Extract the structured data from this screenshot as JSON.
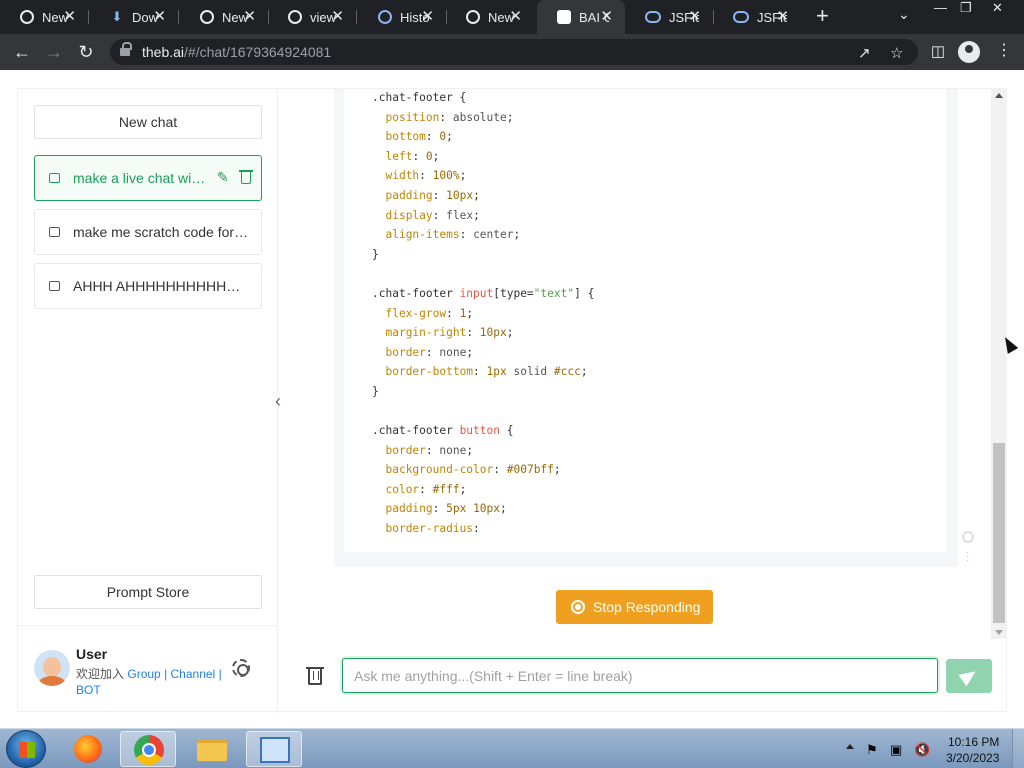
{
  "browser": {
    "tabs": [
      {
        "title": "New",
        "icon": "chrome-icon"
      },
      {
        "title": "Dow",
        "icon": "download-icon"
      },
      {
        "title": "New",
        "icon": "chrome-icon"
      },
      {
        "title": "view",
        "icon": "chrome-icon"
      },
      {
        "title": "Histo",
        "icon": "history-icon"
      },
      {
        "title": "New",
        "icon": "chrome-icon"
      },
      {
        "title": "BAI C",
        "icon": "bai-icon",
        "active": true
      },
      {
        "title": "JSFid",
        "icon": "jsfiddle-icon"
      },
      {
        "title": "JSFid",
        "icon": "jsfiddle-icon"
      }
    ],
    "close_glyph": "✕",
    "new_tab_glyph": "+",
    "url_host": "theb.ai",
    "url_path": "/#/chat/1679364924081"
  },
  "sidebar": {
    "new_chat_label": "New chat",
    "chats": [
      {
        "label": "make a live chat with html css and javascript",
        "active": true
      },
      {
        "label": "make me scratch code for a game",
        "active": false
      },
      {
        "label": "AHHH AHHHHHHHHHHHHHHHH",
        "active": false
      }
    ],
    "prompt_store_label": "Prompt Store",
    "user": {
      "name": "User",
      "join_text": "欢迎加入",
      "links": [
        "Group",
        "Channel",
        "BOT"
      ],
      "separator": " | "
    }
  },
  "code": {
    "lines": [
      [
        [
          "sel",
          ".chat-footer {"
        ]
      ],
      [
        [
          "",
          "  "
        ],
        [
          "prop",
          "position"
        ],
        [
          "",
          ": "
        ],
        [
          "val",
          "absolute"
        ],
        [
          "",
          ";"
        ]
      ],
      [
        [
          "",
          "  "
        ],
        [
          "prop",
          "bottom"
        ],
        [
          "",
          ": "
        ],
        [
          "num",
          "0"
        ],
        [
          "",
          ";"
        ]
      ],
      [
        [
          "",
          "  "
        ],
        [
          "prop",
          "left"
        ],
        [
          "",
          ": "
        ],
        [
          "num",
          "0"
        ],
        [
          "",
          ";"
        ]
      ],
      [
        [
          "",
          "  "
        ],
        [
          "prop",
          "width"
        ],
        [
          "",
          ": "
        ],
        [
          "num",
          "100%"
        ],
        [
          "",
          ";"
        ]
      ],
      [
        [
          "",
          "  "
        ],
        [
          "prop",
          "padding"
        ],
        [
          "",
          ": "
        ],
        [
          "num",
          "10px"
        ],
        [
          "",
          ";"
        ]
      ],
      [
        [
          "",
          "  "
        ],
        [
          "prop",
          "display"
        ],
        [
          "",
          ": "
        ],
        [
          "val",
          "flex"
        ],
        [
          "",
          ";"
        ]
      ],
      [
        [
          "",
          "  "
        ],
        [
          "prop",
          "align-items"
        ],
        [
          "",
          ": "
        ],
        [
          "val",
          "center"
        ],
        [
          "",
          ";"
        ]
      ],
      [
        [
          "sel",
          "}"
        ]
      ],
      [
        [
          "",
          ""
        ]
      ],
      [
        [
          "sel",
          ".chat-footer "
        ],
        [
          "tag",
          "input"
        ],
        [
          "sel",
          "[type="
        ],
        [
          "str",
          "\"text\""
        ],
        [
          "sel",
          "] {"
        ]
      ],
      [
        [
          "",
          "  "
        ],
        [
          "prop",
          "flex-grow"
        ],
        [
          "",
          ": "
        ],
        [
          "num",
          "1"
        ],
        [
          "",
          ";"
        ]
      ],
      [
        [
          "",
          "  "
        ],
        [
          "prop",
          "margin-right"
        ],
        [
          "",
          ": "
        ],
        [
          "num",
          "10px"
        ],
        [
          "",
          ";"
        ]
      ],
      [
        [
          "",
          "  "
        ],
        [
          "prop",
          "border"
        ],
        [
          "",
          ": "
        ],
        [
          "val",
          "none"
        ],
        [
          "",
          ";"
        ]
      ],
      [
        [
          "",
          "  "
        ],
        [
          "prop",
          "border-bottom"
        ],
        [
          "",
          ": "
        ],
        [
          "num",
          "1px"
        ],
        [
          "val",
          " solid "
        ],
        [
          "num",
          "#ccc"
        ],
        [
          "",
          ";"
        ]
      ],
      [
        [
          "sel",
          "}"
        ]
      ],
      [
        [
          "",
          ""
        ]
      ],
      [
        [
          "sel",
          ".chat-footer "
        ],
        [
          "tag",
          "button"
        ],
        [
          "sel",
          " {"
        ]
      ],
      [
        [
          "",
          "  "
        ],
        [
          "prop",
          "border"
        ],
        [
          "",
          ": "
        ],
        [
          "val",
          "none"
        ],
        [
          "",
          ";"
        ]
      ],
      [
        [
          "",
          "  "
        ],
        [
          "prop",
          "background-color"
        ],
        [
          "",
          ": "
        ],
        [
          "num",
          "#007bff"
        ],
        [
          "",
          ";"
        ]
      ],
      [
        [
          "",
          "  "
        ],
        [
          "prop",
          "color"
        ],
        [
          "",
          ": "
        ],
        [
          "num",
          "#fff"
        ],
        [
          "",
          ";"
        ]
      ],
      [
        [
          "",
          "  "
        ],
        [
          "prop",
          "padding"
        ],
        [
          "",
          ": "
        ],
        [
          "num",
          "5px 10px"
        ],
        [
          "",
          ";"
        ]
      ],
      [
        [
          "",
          "  "
        ],
        [
          "prop",
          "border-radius"
        ],
        [
          "",
          ":"
        ]
      ]
    ]
  },
  "main": {
    "stop_label": "Stop Responding",
    "input_placeholder": "Ask me anything...(Shift + Enter = line break)",
    "input_value": ""
  },
  "taskbar": {
    "time": "10:16 PM",
    "date": "3/20/2023"
  },
  "colors": {
    "accent_green": "#18a058",
    "stop_orange": "#f0a020",
    "link_blue": "#2080f0"
  }
}
